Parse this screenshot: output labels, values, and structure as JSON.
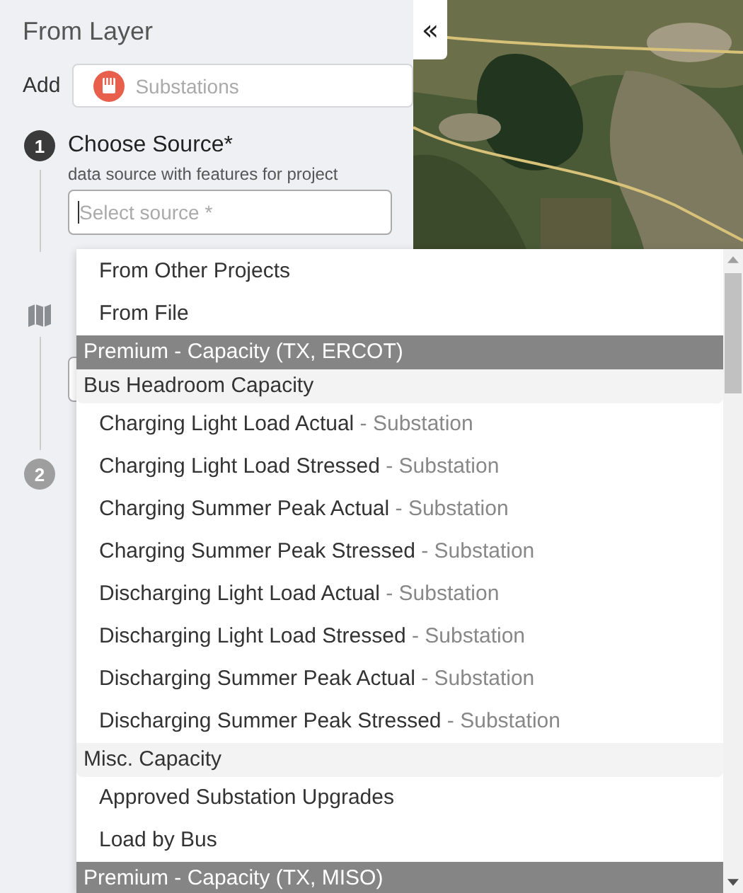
{
  "panel": {
    "title": "From Layer",
    "add_label": "Add",
    "layer_field": {
      "placeholder": "Substations"
    },
    "steps": [
      {
        "kind": "numbered",
        "badge": "1",
        "title": "Choose Source*",
        "subtitle": "data source with features for project",
        "active": true
      },
      {
        "kind": "map"
      },
      {
        "kind": "numbered",
        "badge": "2",
        "active": false
      }
    ],
    "source_field": {
      "placeholder": "Select source *"
    }
  },
  "collapse_button": "«",
  "dropdown": {
    "items": [
      {
        "kind": "option",
        "label": "From Other Projects"
      },
      {
        "kind": "option",
        "label": "From File"
      },
      {
        "kind": "premium",
        "label": "Premium - Capacity (TX, ERCOT)"
      },
      {
        "kind": "group",
        "label": "Bus Headroom Capacity"
      },
      {
        "kind": "option",
        "label": "Charging Light Load Actual",
        "suffix": "- Substation"
      },
      {
        "kind": "option",
        "label": "Charging Light Load Stressed",
        "suffix": "- Substation"
      },
      {
        "kind": "option",
        "label": "Charging Summer Peak Actual",
        "suffix": "- Substation"
      },
      {
        "kind": "option",
        "label": "Charging Summer Peak Stressed",
        "suffix": "- Substation"
      },
      {
        "kind": "option",
        "label": "Discharging Light Load Actual",
        "suffix": "- Substation"
      },
      {
        "kind": "option",
        "label": "Discharging Light Load Stressed",
        "suffix": "- Substation"
      },
      {
        "kind": "option",
        "label": "Discharging Summer Peak Actual",
        "suffix": "- Substation"
      },
      {
        "kind": "option",
        "label": "Discharging Summer Peak Stressed",
        "suffix": "- Substation"
      },
      {
        "kind": "group",
        "label": "Misc. Capacity"
      },
      {
        "kind": "option",
        "label": "Approved Substation Upgrades"
      },
      {
        "kind": "option",
        "label": "Load by Bus"
      },
      {
        "kind": "premium",
        "label": "Premium - Capacity (TX, MISO)"
      }
    ]
  }
}
